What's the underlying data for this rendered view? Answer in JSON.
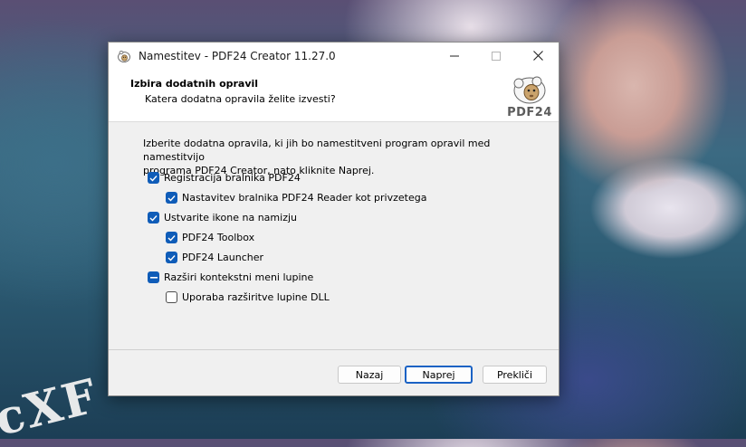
{
  "background": {
    "watermark_text": "cXF"
  },
  "window": {
    "title": "Namestitev - PDF24 Creator 11.27.0",
    "controls": [
      "minimize-icon",
      "maximize-icon",
      "close-icon"
    ]
  },
  "header": {
    "title": "Izbira dodatnih opravil",
    "subtitle": "Katera dodatna opravila želite izvesti?",
    "logo_text": "PDF24"
  },
  "content": {
    "description_line1": "Izberite dodatna opravila, ki jih bo namestitveni program opravil med namestitvijo",
    "description_line2": "programa PDF24 Creator, nato kliknite Naprej.",
    "options": [
      {
        "label": "Registracija bralnika PDF24",
        "state": "checked",
        "level": 0
      },
      {
        "label": "Nastavitev bralnika PDF24 Reader kot privzetega",
        "state": "checked",
        "level": 1
      },
      {
        "label": "Ustvarite ikone na namizju",
        "state": "checked",
        "level": 0
      },
      {
        "label": "PDF24 Toolbox",
        "state": "checked",
        "level": 1
      },
      {
        "label": "PDF24 Launcher",
        "state": "checked",
        "level": 1
      },
      {
        "label": "Razširi kontekstni meni lupine",
        "state": "partial",
        "level": 0
      },
      {
        "label": "Uporaba razširitve lupine DLL",
        "state": "unchecked",
        "level": 1
      }
    ]
  },
  "buttons": {
    "back": "Nazaj",
    "next": "Naprej",
    "cancel": "Prekliči"
  },
  "colors": {
    "accent": "#0f5cb8",
    "dialog_bg": "#f0f0f0",
    "header_bg": "#ffffff"
  }
}
